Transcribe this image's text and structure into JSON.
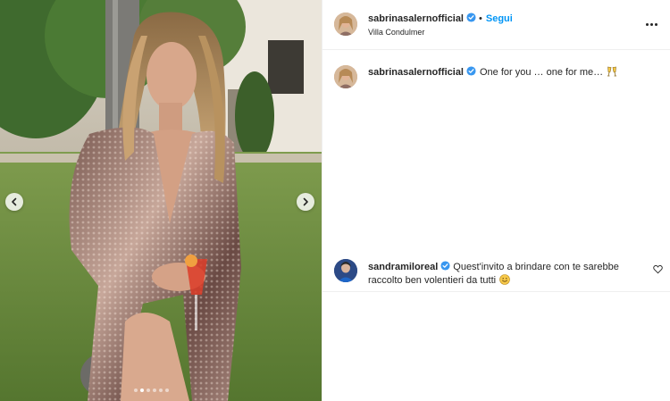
{
  "post": {
    "author": "sabrinasalernofficial",
    "separator": "•",
    "follow_label": "Segui",
    "location": "Villa Condulmer",
    "caption": "One for you … one for me…",
    "caption_emoji": "clinking-glasses-icon",
    "more_icon": "more-options-icon",
    "carousel": {
      "slide_count": 6,
      "active_index": 1
    }
  },
  "comments": [
    {
      "author": "sandramiloreal",
      "text": "Quest'invito a brindare con te sarebbe raccolto ben volentieri da tutti",
      "emoji": "smiling-face-icon",
      "like_icon": "heart-icon"
    }
  ],
  "colors": {
    "accent": "#0095f6",
    "verified": "#3897f0",
    "text": "#262626",
    "divider": "#efefef"
  }
}
